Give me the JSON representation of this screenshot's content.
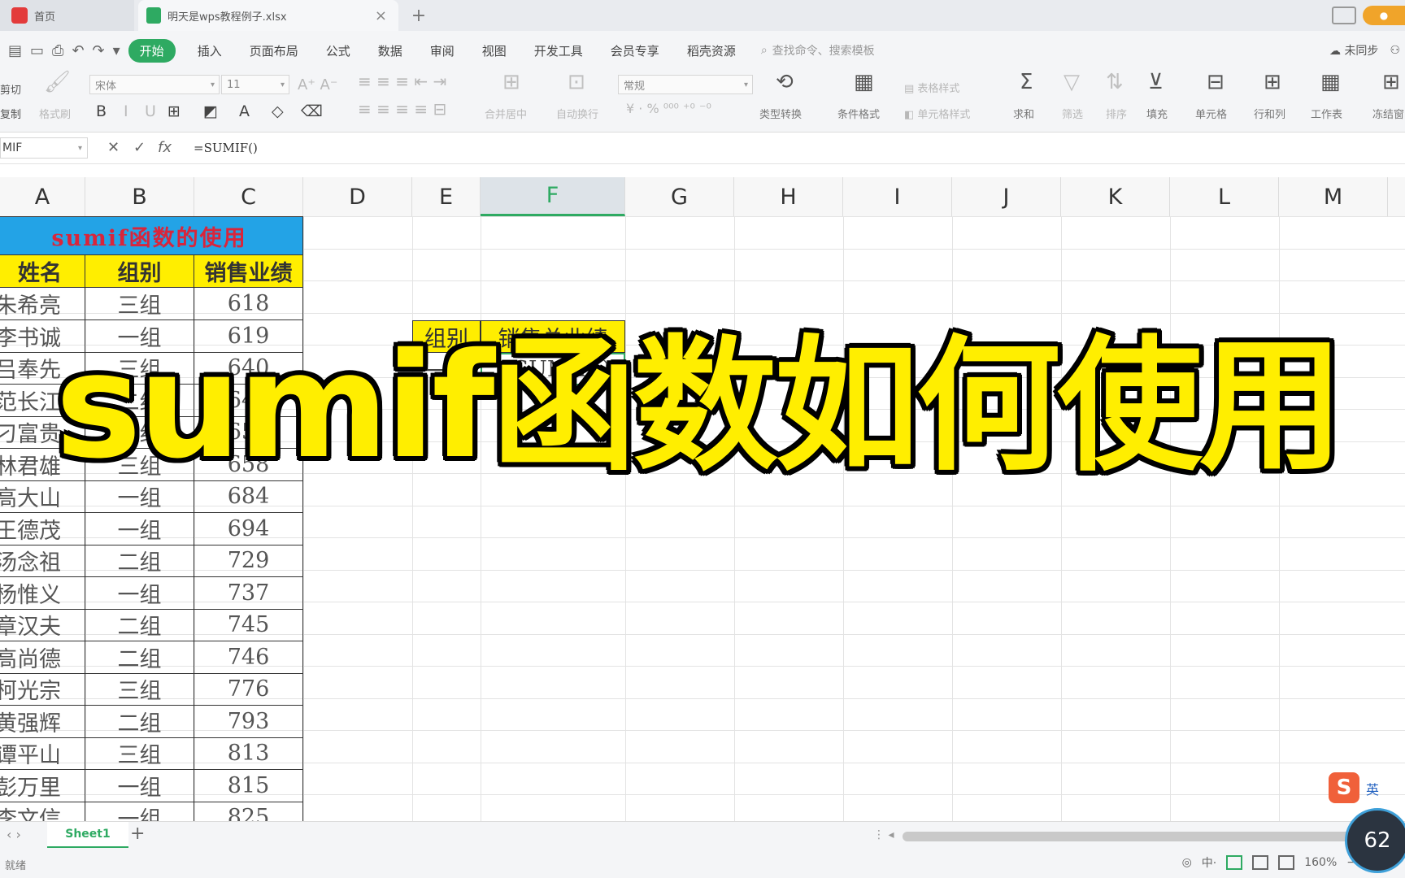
{
  "tabs": {
    "home_label": "首页",
    "file_name": "明天是wps教程例子.xlsx"
  },
  "menu": {
    "items": [
      "开始",
      "插入",
      "页面布局",
      "公式",
      "数据",
      "审阅",
      "视图",
      "开发工具",
      "会员专享",
      "稻壳资源"
    ],
    "search_placeholder": "查找命令、搜索模板",
    "sync_label": "未同步"
  },
  "ribbon": {
    "cut": "剪切",
    "copy": "复制",
    "format_painter": "格式刷",
    "font_name": "宋体",
    "font_size": "11",
    "merge_center": "合并居中",
    "wrap_text": "自动换行",
    "number_format": "常规",
    "type_convert": "类型转换",
    "cond_format": "条件格式",
    "table_style": "表格样式",
    "cell_style": "单元格样式",
    "sum": "求和",
    "filter": "筛选",
    "sort": "排序",
    "fill": "填充",
    "cell": "单元格",
    "row_col": "行和列",
    "worksheet": "工作表",
    "freeze": "冻结窗"
  },
  "formula_bar": {
    "name_box": "MIF",
    "formula": "=SUMIF()"
  },
  "columns": [
    "A",
    "B",
    "C",
    "D",
    "E",
    "F",
    "G",
    "H",
    "I",
    "J",
    "K",
    "L",
    "M"
  ],
  "table": {
    "title": "sumif函数的使用",
    "headers": [
      "姓名",
      "组别",
      "销售业绩"
    ],
    "rows": [
      [
        "朱希亮",
        "三组",
        "618"
      ],
      [
        "李书诚",
        "一组",
        "619"
      ],
      [
        "吕奉先",
        "三组",
        "640"
      ],
      [
        "范长江",
        "二组",
        "640"
      ],
      [
        "刁富贵",
        "一组",
        "651"
      ],
      [
        "林君雄",
        "三组",
        "658"
      ],
      [
        "高大山",
        "一组",
        "684"
      ],
      [
        "王德茂",
        "一组",
        "694"
      ],
      [
        "汤念祖",
        "二组",
        "729"
      ],
      [
        "杨惟义",
        "一组",
        "737"
      ],
      [
        "章汉夫",
        "二组",
        "745"
      ],
      [
        "高尚德",
        "二组",
        "746"
      ],
      [
        "柯光宗",
        "三组",
        "776"
      ],
      [
        "黄强辉",
        "二组",
        "793"
      ],
      [
        "谭平山",
        "三组",
        "813"
      ],
      [
        "彭万里",
        "一组",
        "815"
      ],
      [
        "李文信",
        "一组",
        "825"
      ]
    ]
  },
  "summary": {
    "header_group": "组别",
    "header_total": "销售总业绩",
    "group_value": "一组",
    "formula_value": "=SUMIF()"
  },
  "overlay_caption": "sumif函数如何使用",
  "sheet": {
    "tab": "Sheet1"
  },
  "status": {
    "left": "就绪",
    "zoom": "160%",
    "perf": "62"
  },
  "ime": {
    "logo": "S",
    "label": "英"
  },
  "colors": {
    "accent": "#2eaa62",
    "title_bg": "#23a3e6",
    "title_text": "#d9253b",
    "header_bg": "#ffee00"
  }
}
